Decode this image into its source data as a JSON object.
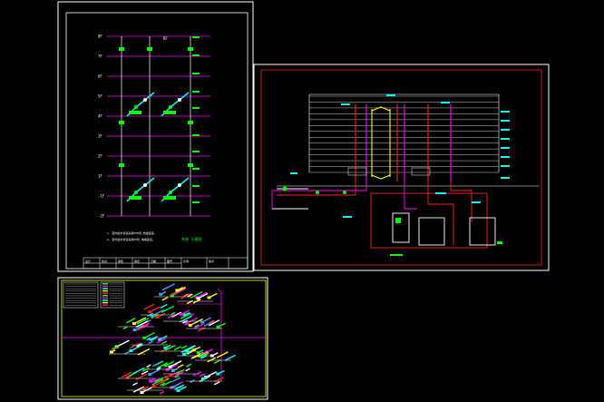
{
  "drawing_sheets": [
    {
      "id": "riser-diagram-sheet",
      "floor_labels": [
        "8F",
        "7F",
        "6F",
        "5F",
        "4F",
        "3F",
        "2F",
        "1F",
        "-1F",
        "-2F"
      ],
      "title_text": "系统  示意图",
      "notes": [
        "1. 室内给水管道采用PPR管,热熔连接。",
        "2. 室外给水管道采用PE管,电熔连接。"
      ],
      "title_block_cells": [
        "设计",
        "校对",
        "审核",
        "审定",
        "日期",
        "图号",
        "比例",
        "版次"
      ]
    },
    {
      "id": "section-elevation-sheet",
      "level_count": 14
    },
    {
      "id": "isometric-pipe-sheet",
      "legend_rows": 10
    }
  ],
  "colors": {
    "background": "#000000",
    "sheet_border": "#ffffff",
    "frame_red": "#ff2020",
    "frame_yellow": "#ffff00",
    "magenta": "#ff00ff",
    "green": "#00ff00",
    "cyan": "#00ffff",
    "white": "#ffffff"
  }
}
